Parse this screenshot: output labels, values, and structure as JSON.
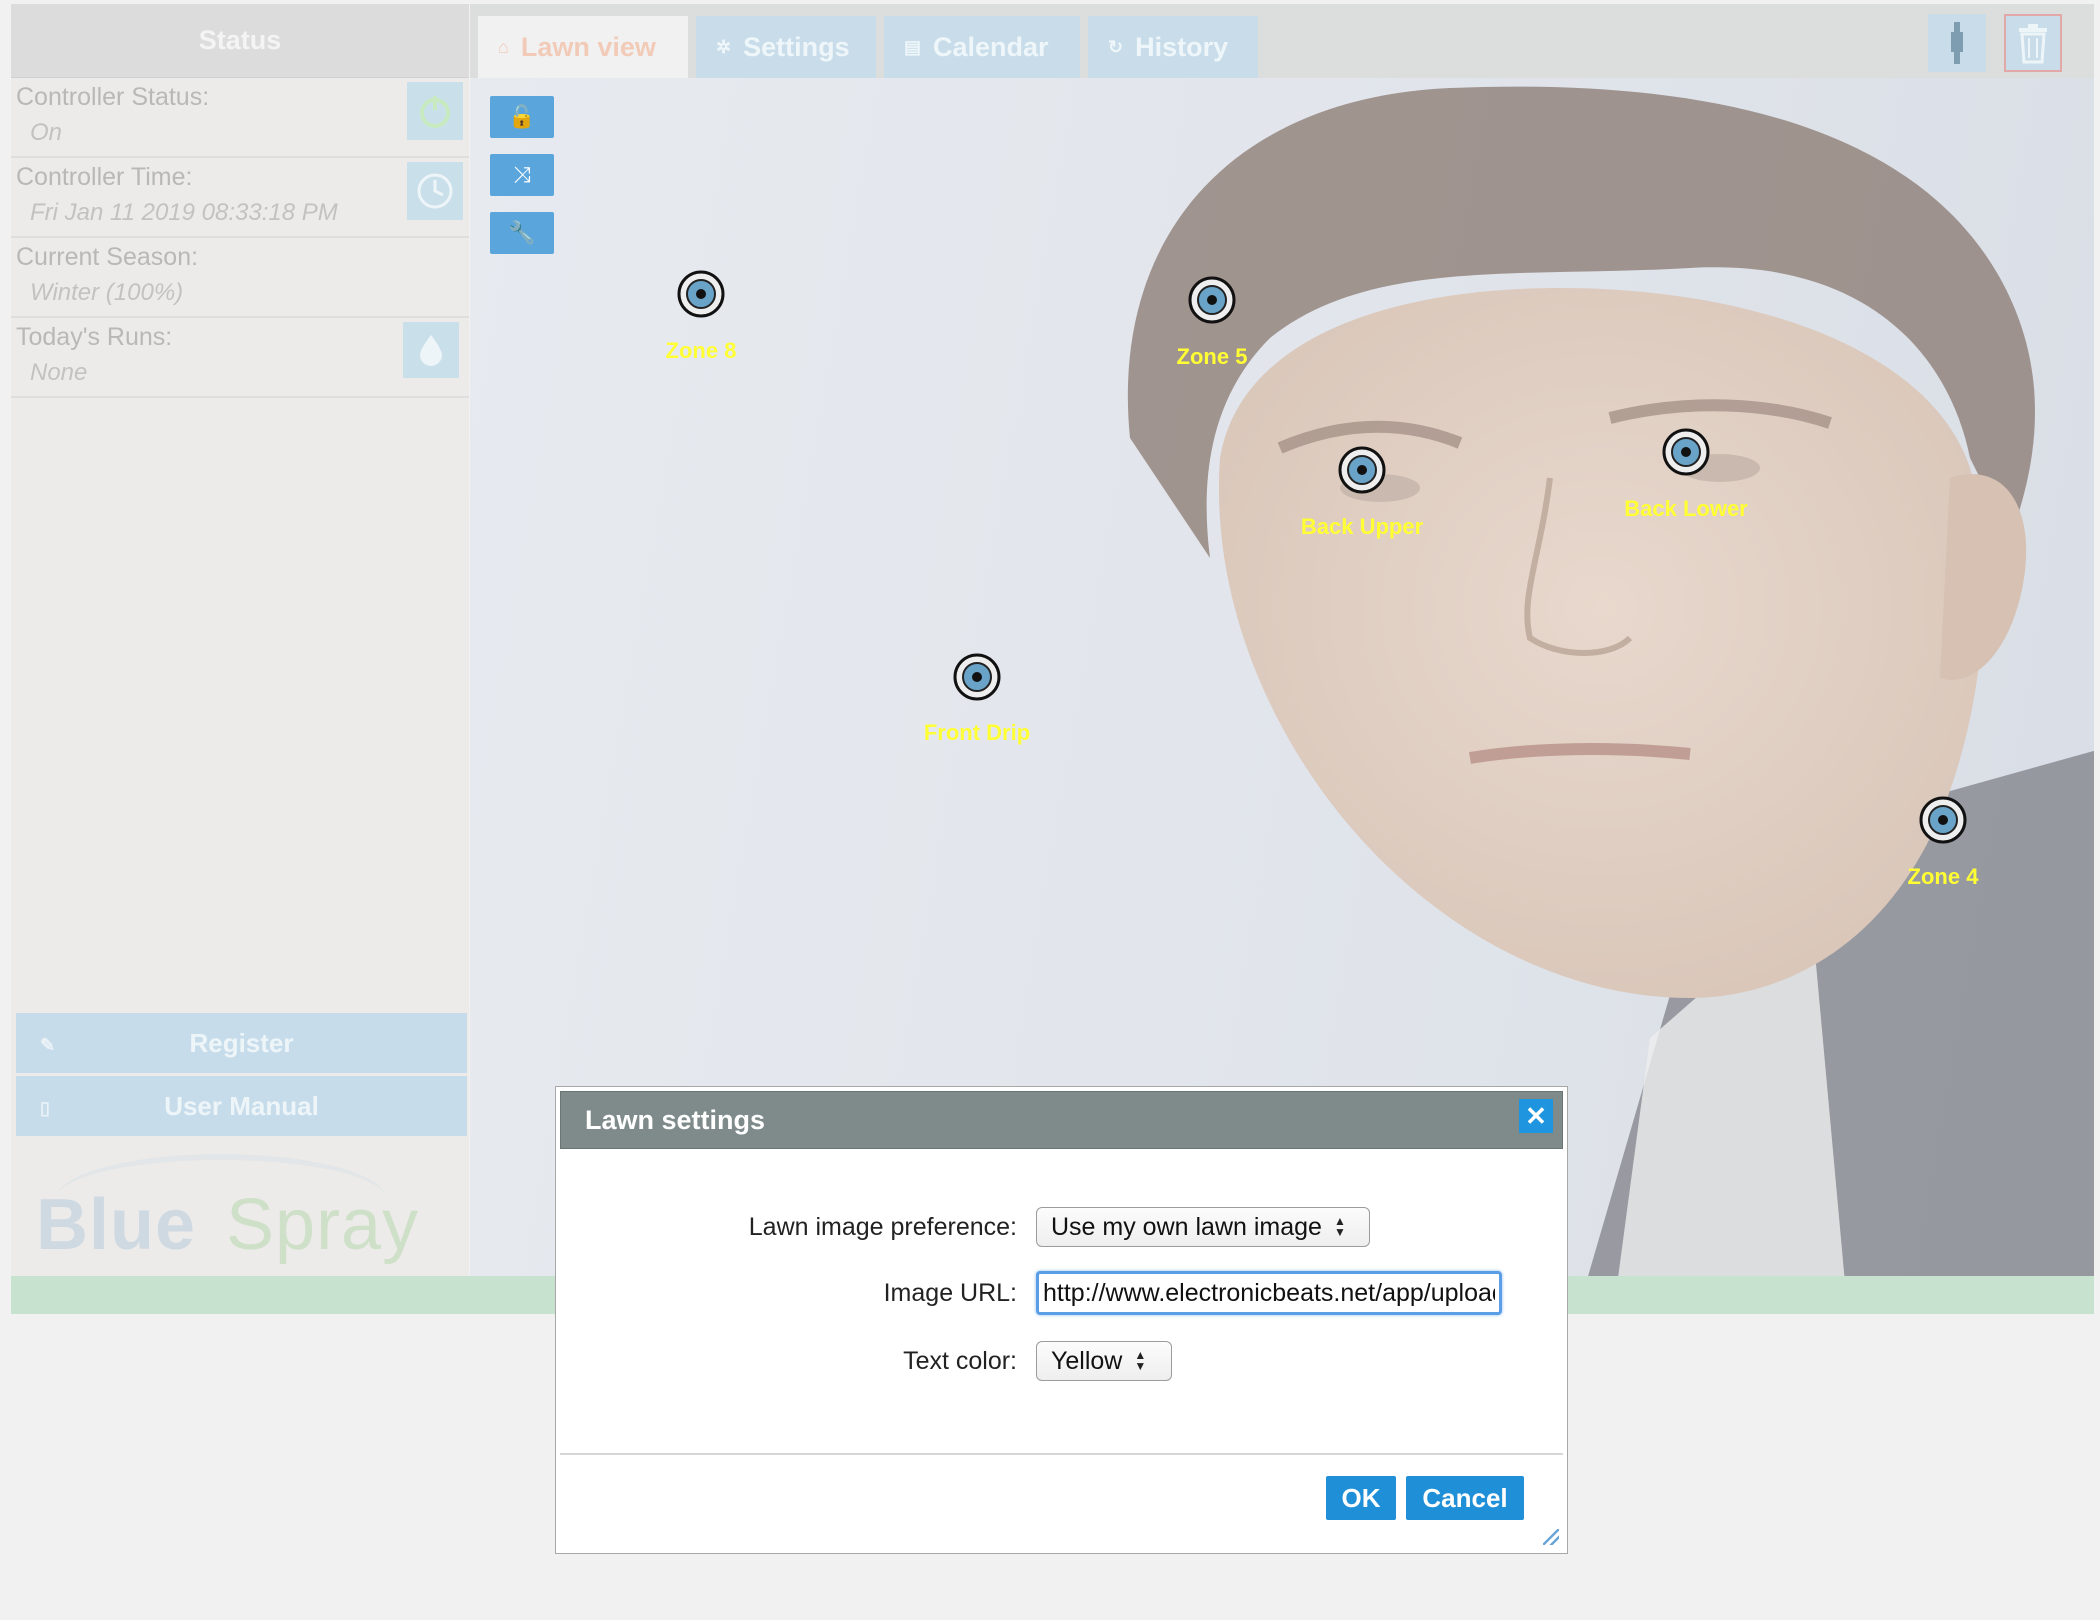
{
  "sidebar": {
    "header": "Status",
    "rows": [
      {
        "label": "Controller Status:",
        "value": "On",
        "icon": "power-icon"
      },
      {
        "label": "Controller Time:",
        "value": "Fri Jan 11 2019 08:33:18 PM",
        "icon": "clock-icon"
      },
      {
        "label": "Current Season:",
        "value": "Winter (100%)"
      },
      {
        "label": "Today's Runs:",
        "value": "None",
        "icon": "water-drop-icon"
      }
    ],
    "register_label": "Register",
    "manual_label": "User Manual",
    "logo_blue": "Blue",
    "logo_green": "Spray"
  },
  "tabs": [
    {
      "label": "Lawn view",
      "icon": "home-icon"
    },
    {
      "label": "Settings",
      "icon": "gear-icon"
    },
    {
      "label": "Calendar",
      "icon": "calendar-icon"
    },
    {
      "label": "History",
      "icon": "history-icon"
    }
  ],
  "zones": [
    {
      "label": "Zone 8"
    },
    {
      "label": "Zone 5"
    },
    {
      "label": "Back Upper"
    },
    {
      "label": "Back Lower"
    },
    {
      "label": "Front Drip"
    },
    {
      "label": "Zone 4"
    }
  ],
  "dialog": {
    "title": "Lawn settings",
    "pref_label": "Lawn image preference:",
    "pref_value": "Use my own lawn image",
    "url_label": "Image URL:",
    "url_value": "http://www.electronicbeats.net/app/uploads",
    "color_label": "Text color:",
    "color_value": "Yellow",
    "ok_label": "OK",
    "cancel_label": "Cancel"
  },
  "colors": {
    "accent": "#1f8fd8",
    "zone_text": "#ffff33",
    "dialog_header": "#7f8a8a"
  }
}
